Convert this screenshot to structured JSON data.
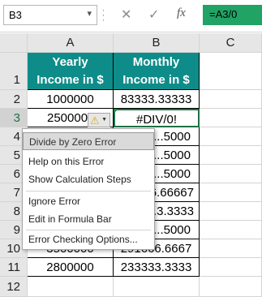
{
  "formula_bar": {
    "name_box": "B3",
    "dropdown_arrow": "▾",
    "cancel_glyph": "✕",
    "enter_glyph": "✓",
    "fx_label": "fx",
    "formula": "=A3/0"
  },
  "columns": [
    "A",
    "B",
    "C"
  ],
  "rows": [
    "1",
    "2",
    "3",
    "4",
    "5",
    "6",
    "7",
    "8",
    "9",
    "10",
    "11",
    "12"
  ],
  "table": {
    "header_a": [
      "Yearly",
      "Income in $"
    ],
    "header_b": [
      "Monthly",
      "Income in $"
    ],
    "a_values": [
      "1000000",
      "250000",
      "",
      "",
      "",
      "",
      "",
      "",
      "2800000"
    ],
    "b_values": [
      "83333.33333",
      "#DIV/0!",
      "...5000",
      "...5000",
      "...5000",
      "...6.66667",
      "...3.3333",
      "...5000",
      "233333.3333"
    ],
    "a_row10": "3500000",
    "b_row10": "291666.6667"
  },
  "error_menu": {
    "title": "Divide by Zero Error",
    "items": [
      "Help on this Error",
      "Show Calculation Steps",
      "Ignore Error",
      "Edit in Formula Bar",
      "Error Checking Options..."
    ]
  },
  "icons": {
    "error_icon": "warning-icon",
    "error_glyph": "⚠",
    "error_dropdown": "▼"
  },
  "colors": {
    "header_fill": "#0e8c89",
    "formula_fill": "#21a366",
    "error_icon_fill": "#e2a800"
  }
}
